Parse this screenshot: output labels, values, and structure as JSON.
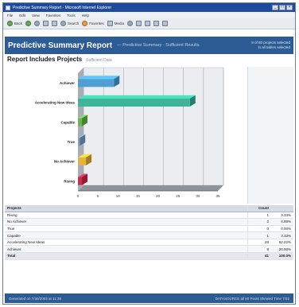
{
  "window": {
    "title": "Predictive Summary Report - Microsoft Internet Explorer"
  },
  "menu": [
    "File",
    "Edit",
    "View",
    "Favorites",
    "Tools",
    "Help"
  ],
  "toolbar": {
    "back": "Back",
    "search": "Search",
    "favorites": "Favorites",
    "media": "Media"
  },
  "report": {
    "title": "Predictive Summary Report",
    "subtitle": "— Predictive Summary - Sufficient Results",
    "status_line1": "9 of 80 projects selected",
    "status_line2": "in all tables selected"
  },
  "section": {
    "title": "Report Includes Projects",
    "subtitle": "Sufficient Data"
  },
  "chart_data": {
    "type": "bar",
    "orientation": "horizontal",
    "categories": [
      "Achiever",
      "Accelerating New Ideas",
      "Capable",
      "True",
      "No Achiever",
      "Rising"
    ],
    "values": [
      9,
      28,
      1,
      0,
      2,
      1
    ],
    "colors": [
      "#4f9fd4",
      "#3fb497",
      "#68b84f",
      "#7aa2c8",
      "#e3b33a",
      "#c92d4b"
    ],
    "x_ticks": [
      "0",
      "5",
      "10",
      "15",
      "20",
      "25",
      "30",
      "35"
    ],
    "xlim": [
      0,
      35
    ],
    "grid": true
  },
  "table": {
    "headers": [
      "Projects",
      "Count",
      ""
    ],
    "rows": [
      {
        "name": "Rising",
        "count": "1",
        "pct": "3.33%"
      },
      {
        "name": "No Achiever",
        "count": "2",
        "pct": "4.89%"
      },
      {
        "name": "True",
        "count": "0",
        "pct": "0.00%"
      },
      {
        "name": "Capable",
        "count": "1",
        "pct": "3.33%"
      },
      {
        "name": "Accelerating New Ideas",
        "count": "28",
        "pct": "62.22%"
      },
      {
        "name": "Achiever",
        "count": "9",
        "pct": "20.00%"
      }
    ],
    "total": {
      "name": "Total",
      "count": "41",
      "pct": "100.0%"
    }
  },
  "footer": {
    "left": "Generated on 7/30/2003 at 11:38",
    "right": "DATASOURCE all 80 Pools Skewed Time 7/32"
  }
}
